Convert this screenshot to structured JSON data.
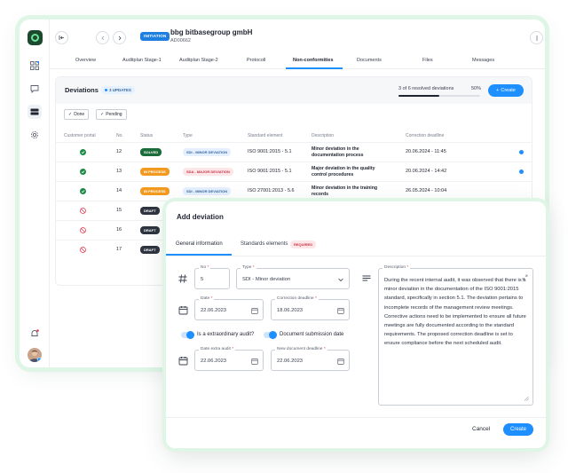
{
  "header": {
    "badge": "INITIATION",
    "company": "bbg bitbasegroup gmbH",
    "code": "AD00662"
  },
  "tabs": [
    {
      "label": "Overview"
    },
    {
      "label": "Auditplan Stage-1"
    },
    {
      "label": "Auditplan Stage-2"
    },
    {
      "label": "Protocoll"
    },
    {
      "label": "Non-conformities"
    },
    {
      "label": "Documents"
    },
    {
      "label": "Files"
    },
    {
      "label": "Messages"
    }
  ],
  "active_tab": "Non-conformities",
  "deviations": {
    "title": "Deviations",
    "updates_badge": "3 UPDATES",
    "resolved_text": "3 of 6 resolved deviations",
    "resolved_percent": "50%",
    "resolved_fraction": 0.5,
    "create_label": "Create",
    "filters": [
      {
        "label": "Done"
      },
      {
        "label": "Pending"
      }
    ],
    "columns": {
      "customer_portal": "Customer portal",
      "no": "No.",
      "status": "Status",
      "type": "Type",
      "standard": "Standard element",
      "description": "Description",
      "deadline": "Correction deadline"
    },
    "rows": [
      {
        "portal": "check",
        "no": "12",
        "status": "SOLVED",
        "type": "SDI - MINOR DEVIATION",
        "standard": "ISO 9001:2015 - 5.1",
        "description": "Minor deviation in the documentation process",
        "deadline": "20.06.2024 - 11:45",
        "dot": true
      },
      {
        "portal": "check",
        "no": "13",
        "status": "IN PROCESS",
        "type": "SDA - MAJOR DEVIATION",
        "standard": "ISO 9001:2015 - 5.1",
        "description": "Major deviation in the quality control procedures",
        "deadline": "20.06.2024 - 14:42",
        "dot": true
      },
      {
        "portal": "check",
        "no": "14",
        "status": "IN PROCESS",
        "type": "SDI - MINOR DEVIATION",
        "standard": "ISO 27001:2013 - 5.6",
        "description": "Minor deviation in the training records",
        "deadline": "26.05.2024 - 10:04",
        "dot": false
      },
      {
        "portal": "blocked",
        "no": "15",
        "status": "DRAFT",
        "type": "",
        "standard": "",
        "description": "",
        "deadline": "",
        "dot": false
      },
      {
        "portal": "blocked",
        "no": "16",
        "status": "DRAFT",
        "type": "",
        "standard": "",
        "description": "",
        "deadline": "",
        "dot": false
      },
      {
        "portal": "blocked",
        "no": "17",
        "status": "DRAFT",
        "type": "",
        "standard": "",
        "description": "",
        "deadline": "",
        "dot": false
      }
    ]
  },
  "modal": {
    "title": "Add deviation",
    "tab_general": "General information",
    "tab_standards": "Standards elements",
    "required_badge": "REQUIRED",
    "no_label": "No",
    "no_value": "5",
    "type_label": "Type",
    "type_value": "SDI - Minor deviation",
    "date_label": "Date",
    "date_value": "22.06.2023",
    "correction_label": "Correction deadline",
    "correction_value": "18.06.2023",
    "toggle_extra": "Is a extraordinary audit?",
    "toggle_doc": "Document submission date",
    "extra_date_label": "Date extra audit",
    "extra_date_value": "22.06.2023",
    "doc_deadline_label": "New document deadline",
    "doc_deadline_value": "22.06.2023",
    "description_label": "Description",
    "description_value": "During the recent internal audit, it was observed that there is a minor deviation in the documentation of the ISO 9001:2015 standard, specifically in section 5.1. The deviation pertains to incomplete records of the management review meetings. Corrective actions need to be implemented to ensure all future meetings are fully documented according to the standard requirements. The proposed correction deadline is set to ensure compliance before the next scheduled audit.",
    "cancel_label": "Cancel",
    "create_label": "Create"
  },
  "colors": {
    "accent": "#1e8fff",
    "solved": "#1c6b3a",
    "in_process": "#f29a1f",
    "draft": "#2e3440",
    "minor_bg": "#e4efff",
    "minor_fg": "#3a6aa0",
    "major_bg": "#fde6e8",
    "major_fg": "#c73444",
    "check": "#1c8a45",
    "blocked": "#e0394d"
  }
}
